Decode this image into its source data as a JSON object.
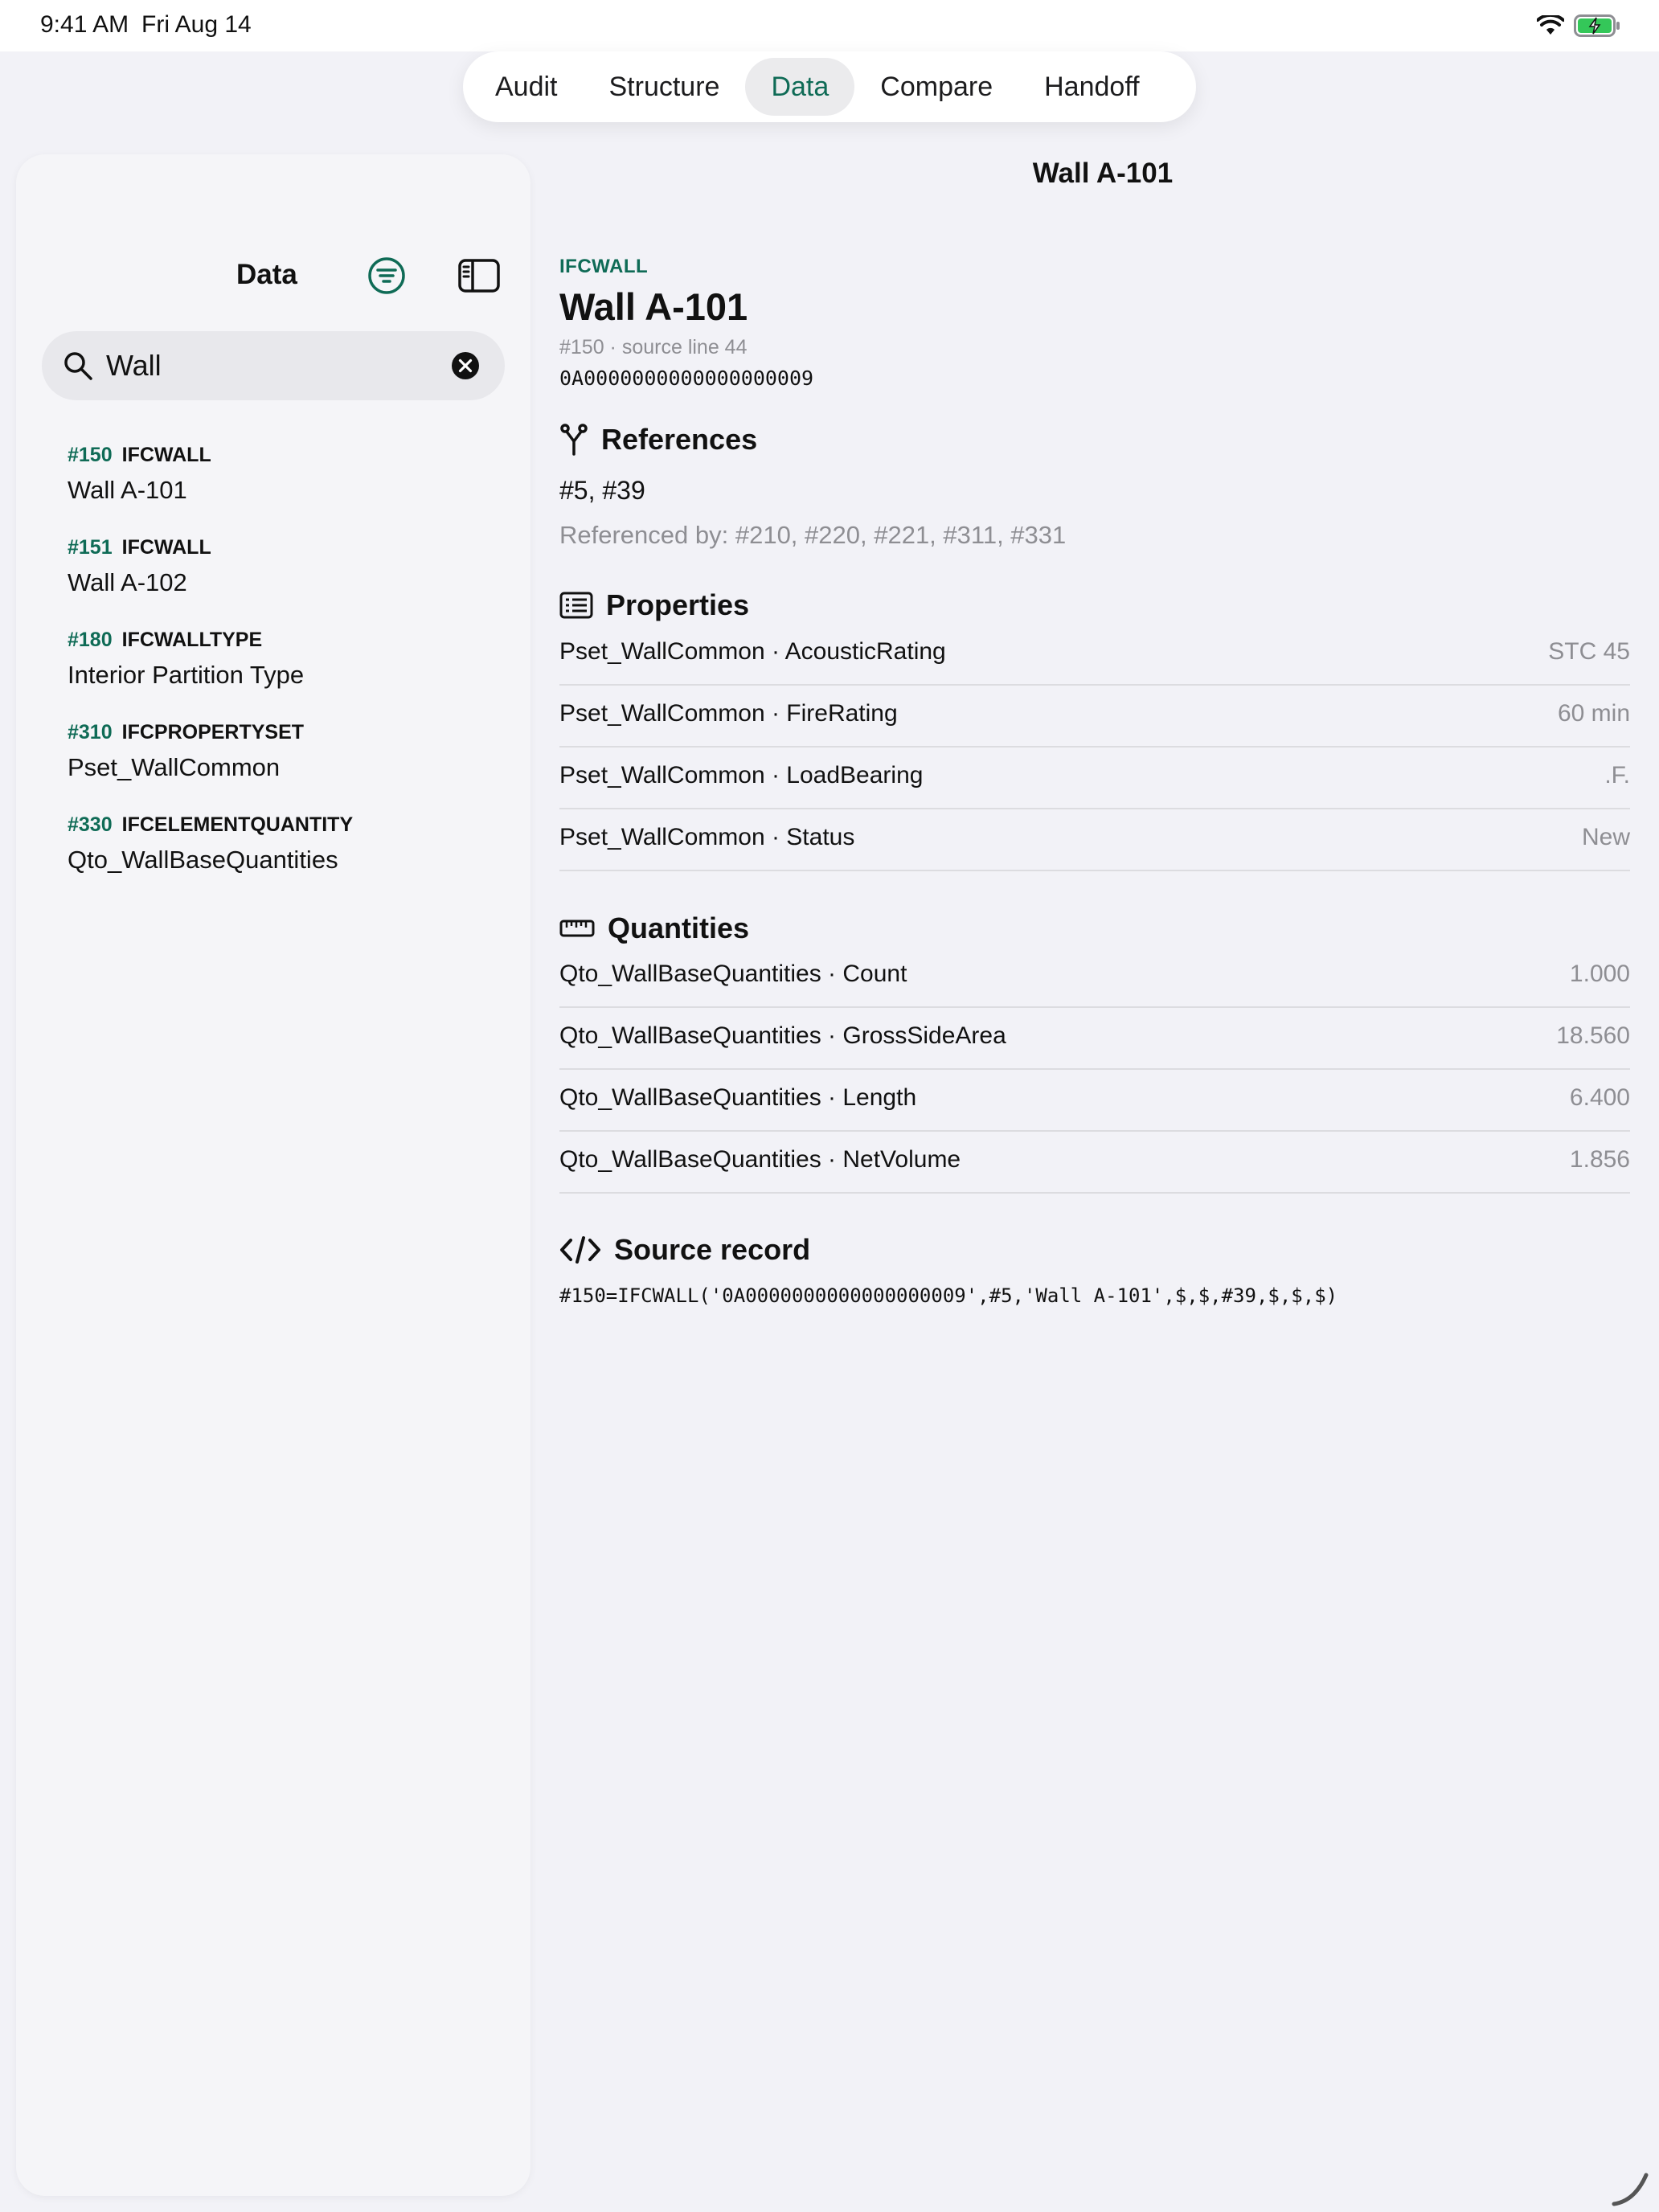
{
  "status_bar": {
    "time": "9:41 AM",
    "date": "Fri Aug 14"
  },
  "tabs": [
    {
      "label": "Audit"
    },
    {
      "label": "Structure"
    },
    {
      "label": "Data",
      "active": true
    },
    {
      "label": "Compare"
    },
    {
      "label": "Handoff"
    }
  ],
  "sidebar": {
    "title": "Data",
    "search": {
      "value": "Wall"
    },
    "results": [
      {
        "id": "#150",
        "type": "IFCWALL",
        "name": "Wall A-101"
      },
      {
        "id": "#151",
        "type": "IFCWALL",
        "name": "Wall A-102"
      },
      {
        "id": "#180",
        "type": "IFCWALLTYPE",
        "name": "Interior Partition Type"
      },
      {
        "id": "#310",
        "type": "IFCPROPERTYSET",
        "name": "Pset_WallCommon"
      },
      {
        "id": "#330",
        "type": "IFCELEMENTQUANTITY",
        "name": "Qto_WallBaseQuantities"
      }
    ]
  },
  "detail": {
    "nav_title": "Wall A-101",
    "entity_type": "IFCWALL",
    "entity_name": "Wall A-101",
    "meta": "#150 · source line 44",
    "guid": "0A0000000000000000009",
    "references": {
      "heading": "References",
      "refs": "#5, #39",
      "referenced_by": "Referenced by: #210, #220, #221, #311, #331"
    },
    "properties": {
      "heading": "Properties",
      "rows": [
        {
          "key": "Pset_WallCommon · AcousticRating",
          "value": "STC 45"
        },
        {
          "key": "Pset_WallCommon · FireRating",
          "value": "60 min"
        },
        {
          "key": "Pset_WallCommon · LoadBearing",
          "value": ".F."
        },
        {
          "key": "Pset_WallCommon · Status",
          "value": "New"
        }
      ]
    },
    "quantities": {
      "heading": "Quantities",
      "rows": [
        {
          "key": "Qto_WallBaseQuantities · Count",
          "value": "1.000"
        },
        {
          "key": "Qto_WallBaseQuantities · GrossSideArea",
          "value": "18.560"
        },
        {
          "key": "Qto_WallBaseQuantities · Length",
          "value": "6.400"
        },
        {
          "key": "Qto_WallBaseQuantities · NetVolume",
          "value": "1.856"
        }
      ]
    },
    "source": {
      "heading": "Source record",
      "text": "#150=IFCWALL('0A0000000000000000009',#5,'Wall A-101',$,$,#39,$,$,$)"
    }
  },
  "colors": {
    "accent": "#0f6b56",
    "battery": "#34c759"
  }
}
